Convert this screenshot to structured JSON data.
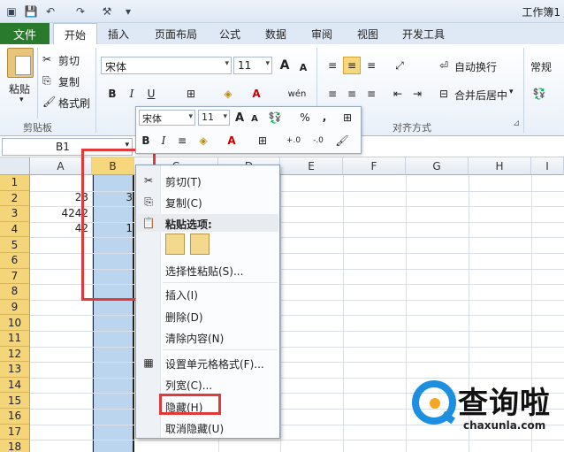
{
  "window": {
    "title": "工作簿1"
  },
  "tabs": [
    "文件",
    "开始",
    "插入",
    "页面布局",
    "公式",
    "数据",
    "审阅",
    "视图",
    "开发工具"
  ],
  "ribbon": {
    "paste": "粘贴",
    "cut": "剪切",
    "copy": "复制",
    "format_painter": "格式刷",
    "clipboard_group": "剪贴板",
    "font_name": "宋体",
    "font_size": "11",
    "bold": "B",
    "italic": "I",
    "underline": "U",
    "wrap_text": "自动换行",
    "merge_center": "合并后居中",
    "align_group": "对齐方式",
    "number_format": "常规",
    "grow_font": "A",
    "shrink_font": "A",
    "phonetic": "wén"
  },
  "formula_bar": {
    "name_box": "B1"
  },
  "grid": {
    "columns": [
      "A",
      "B",
      "C",
      "D",
      "E",
      "F",
      "G",
      "H",
      "I"
    ],
    "rows": [
      "1",
      "2",
      "3",
      "4",
      "5",
      "6",
      "7",
      "8",
      "9",
      "10",
      "11",
      "12",
      "13",
      "14",
      "15",
      "16",
      "17",
      "18"
    ],
    "cells": {
      "A2": "23",
      "A3": "4242",
      "A4": "42",
      "B2": "3",
      "B4": "1"
    }
  },
  "mini_toolbar": {
    "font_name": "宋体",
    "font_size": "11",
    "percent": "%",
    "comma": ",",
    "increase_decimal": "+.0",
    "decrease_decimal": "-.0",
    "bold": "B",
    "italic": "I",
    "grow_font": "A",
    "shrink_font": "A"
  },
  "context_menu": {
    "items": [
      {
        "label": "剪切(T)"
      },
      {
        "label": "复制(C)"
      },
      {
        "label": "粘贴选项:"
      },
      {
        "label": "选择性粘贴(S)..."
      },
      {
        "label": "插入(I)"
      },
      {
        "label": "删除(D)"
      },
      {
        "label": "清除内容(N)"
      },
      {
        "label": "设置单元格格式(F)..."
      },
      {
        "label": "列宽(C)..."
      },
      {
        "label": "隐藏(H)"
      },
      {
        "label": "取消隐藏(U)"
      }
    ]
  },
  "watermark": {
    "brand": "查询啦",
    "url": "chaxunla.com"
  },
  "colors": {
    "file_tab": "#2a7a2e",
    "selection": "#bcd5ee",
    "row_header": "#f5d57a",
    "highlight": "#e03a3a"
  }
}
